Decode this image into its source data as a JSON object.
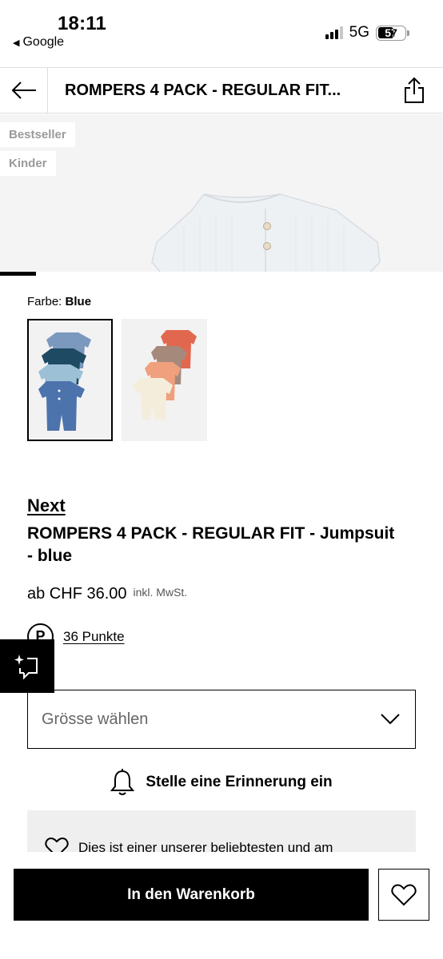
{
  "status_bar": {
    "time": "18:11",
    "back_app": "Google",
    "network": "5G",
    "battery": "57",
    "battery_level_percent": 57
  },
  "header": {
    "title": "ROMPERS 4 PACK - REGULAR FIT...",
    "back_icon": "arrow-left-icon",
    "share_icon": "share-icon"
  },
  "hero": {
    "badges": [
      "Bestseller",
      "Kinder"
    ]
  },
  "color": {
    "label": "Farbe:",
    "selected": "Blue",
    "swatches": [
      "blue",
      "orange"
    ]
  },
  "product": {
    "brand": "Next",
    "name": "ROMPERS 4 PACK - REGULAR FIT - Jumpsuit - blue",
    "price": "ab CHF 36.00",
    "vat_note": "inkl. MwSt.",
    "points": "36 Punkte",
    "points_icon": "P"
  },
  "size": {
    "placeholder": "Grösse wählen"
  },
  "reminder": {
    "label": "Stelle eine Erinnerung ein"
  },
  "info": {
    "text": "Dies ist einer unserer beliebtesten und am"
  },
  "bottom": {
    "cart_label": "In den Warenkorb"
  },
  "colors": {
    "primary": "#000000",
    "badge_text": "#9a9a9a",
    "background": "#ffffff"
  }
}
